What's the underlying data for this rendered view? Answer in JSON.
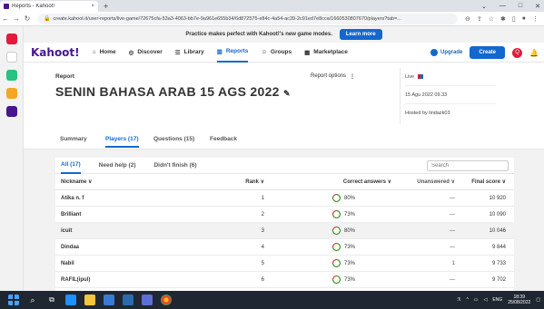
{
  "browser": {
    "tab_title": "Reports - Kahoot!",
    "tab_close": "×",
    "new_tab": "+",
    "url": "create.kahoot.it/user-reports/live-game/72675cfa-53a3-4063-bb7e-9a961e655b34/6d872575-e84c-4a54-ac39-2c91ed7e8cca/1660530807670/players?tab=...",
    "window_controls": [
      "⌄",
      "—",
      "□",
      "✕"
    ]
  },
  "promo": {
    "text": "Practice makes perfect with Kahoot!'s new game modes.",
    "button": "Learn more"
  },
  "nav": {
    "logo": "Kahoot!",
    "items": [
      {
        "label": "Home",
        "icon": "⌂"
      },
      {
        "label": "Discover",
        "icon": "◎"
      },
      {
        "label": "Library",
        "icon": "☰"
      },
      {
        "label": "Reports",
        "icon": "▥"
      },
      {
        "label": "Groups",
        "icon": "☺"
      },
      {
        "label": "Marketplace",
        "icon": "▦"
      }
    ],
    "upgrade": "Upgrade",
    "create": "Create",
    "avatar": "Q"
  },
  "header": {
    "label": "Report",
    "title": "SENIN BAHASA ARAB 15 AGS 2022",
    "edit_icon": "✎",
    "options": "Report options",
    "options_icon": "⋮",
    "info": {
      "mode": "Live",
      "date": "15 Agu 2022 09.33",
      "host": "Hosted by lindazk03"
    }
  },
  "tabs": [
    "Summary",
    "Players (17)",
    "Questions (15)",
    "Feedback"
  ],
  "filters": [
    "All (17)",
    "Need help (2)",
    "Didn't finish (6)"
  ],
  "search_placeholder": "Search",
  "table": {
    "headers": [
      "Nickname ∨",
      "Rank ∨",
      "Correct answers ∨",
      "Unanswered ∨",
      "Final score ∨"
    ],
    "rows": [
      {
        "nickname": "Atika n. f",
        "rank": "1",
        "correct": "80%",
        "unanswered": "—",
        "score": "10 920"
      },
      {
        "nickname": "Brilliant",
        "rank": "2",
        "correct": "73%",
        "unanswered": "—",
        "score": "10 090"
      },
      {
        "nickname": "icuit",
        "rank": "3",
        "correct": "80%",
        "unanswered": "—",
        "score": "10 046"
      },
      {
        "nickname": "Dindaa",
        "rank": "4",
        "correct": "73%",
        "unanswered": "—",
        "score": "9 844"
      },
      {
        "nickname": "Nabil",
        "rank": "5",
        "correct": "73%",
        "unanswered": "1",
        "score": "9 733"
      },
      {
        "nickname": "RAFIL(ipul)",
        "rank": "6",
        "correct": "73%",
        "unanswered": "—",
        "score": "9 702"
      }
    ]
  },
  "taskbar": {
    "lang": "ENG",
    "time": "18:39",
    "date": "25/08/2022"
  },
  "colors": {
    "accent": "#1368ce",
    "brand": "#46178f",
    "correct_ring": "#26890c"
  }
}
